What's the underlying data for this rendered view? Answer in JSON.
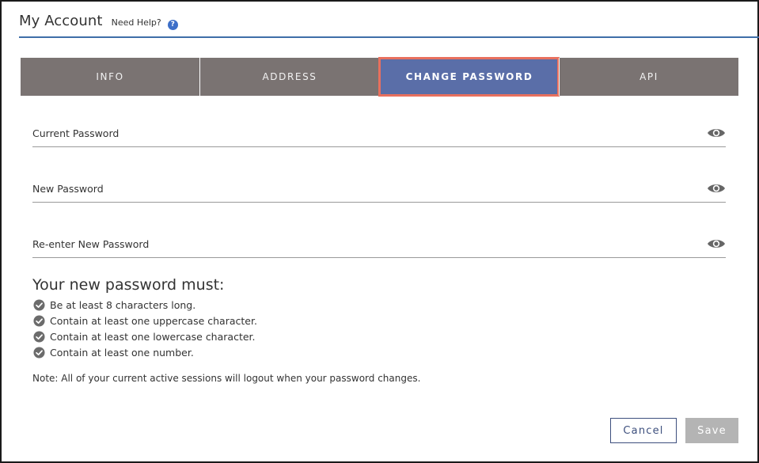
{
  "header": {
    "title": "My Account",
    "help_text": "Need Help?",
    "help_icon": "question-circle-icon"
  },
  "tabs": [
    {
      "label": "INFO",
      "active": false
    },
    {
      "label": "ADDRESS",
      "active": false
    },
    {
      "label": "CHANGE PASSWORD",
      "active": true
    },
    {
      "label": "API",
      "active": false
    }
  ],
  "fields": {
    "current": {
      "placeholder": "Current Password",
      "value": ""
    },
    "new": {
      "placeholder": "New Password",
      "value": ""
    },
    "reenter": {
      "placeholder": "Re-enter New Password",
      "value": ""
    }
  },
  "requirements": {
    "title": "Your new password must:",
    "items": [
      "Be at least 8 characters long.",
      "Contain at least one uppercase character.",
      "Contain at least one lowercase character.",
      "Contain at least one number."
    ]
  },
  "note": "Note: All of your current active sessions will logout when your password changes.",
  "buttons": {
    "cancel": "Cancel",
    "save": "Save"
  },
  "colors": {
    "tab_bar": "#7a7372",
    "tab_active": "#5a6ea8",
    "active_outline": "#e8705e",
    "header_rule": "#3f6ea8",
    "save_disabled": "#b4b4b4"
  }
}
